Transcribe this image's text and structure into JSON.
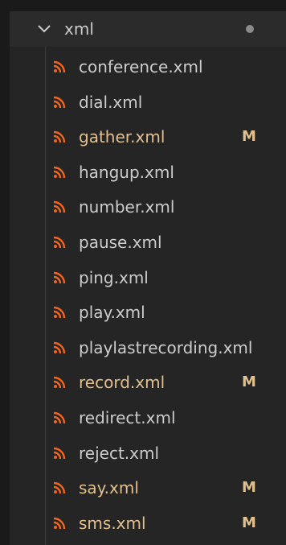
{
  "folder": {
    "label": "xml",
    "expanded": true,
    "has_changes": true,
    "chevron_icon": "chevron-down-icon"
  },
  "colors": {
    "background": "#252526",
    "text": "#cccccc",
    "modified_text": "#e2c08d",
    "rss_icon": "#f26522"
  },
  "files": [
    {
      "name": "conference.xml",
      "icon": "rss-icon",
      "status": ""
    },
    {
      "name": "dial.xml",
      "icon": "rss-icon",
      "status": ""
    },
    {
      "name": "gather.xml",
      "icon": "rss-icon",
      "status": "M"
    },
    {
      "name": "hangup.xml",
      "icon": "rss-icon",
      "status": ""
    },
    {
      "name": "number.xml",
      "icon": "rss-icon",
      "status": ""
    },
    {
      "name": "pause.xml",
      "icon": "rss-icon",
      "status": ""
    },
    {
      "name": "ping.xml",
      "icon": "rss-icon",
      "status": ""
    },
    {
      "name": "play.xml",
      "icon": "rss-icon",
      "status": ""
    },
    {
      "name": "playlastrecording.xml",
      "icon": "rss-icon",
      "status": ""
    },
    {
      "name": "record.xml",
      "icon": "rss-icon",
      "status": "M"
    },
    {
      "name": "redirect.xml",
      "icon": "rss-icon",
      "status": ""
    },
    {
      "name": "reject.xml",
      "icon": "rss-icon",
      "status": ""
    },
    {
      "name": "say.xml",
      "icon": "rss-icon",
      "status": "M"
    },
    {
      "name": "sms.xml",
      "icon": "rss-icon",
      "status": "M"
    }
  ]
}
